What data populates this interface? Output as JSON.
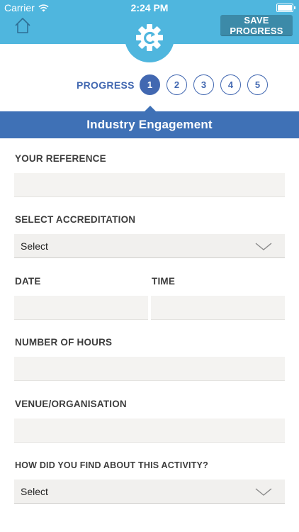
{
  "status_bar": {
    "carrier": "Carrier",
    "time": "2:24 PM"
  },
  "header": {
    "save_label": "SAVE PROGRESS"
  },
  "progress": {
    "label": "PROGRESS",
    "steps": [
      "1",
      "2",
      "3",
      "4",
      "5"
    ],
    "current": 1
  },
  "section_title": "Industry Engagement",
  "form": {
    "reference_label": "YOUR REFERENCE",
    "accreditation_label": "SELECT ACCREDITATION",
    "accreditation_value": "Select",
    "date_label": "DATE",
    "time_label": "TIME",
    "hours_label": "NUMBER OF HOURS",
    "venue_label": "VENUE/ORGANISATION",
    "found_label": "HOW DID YOU FIND ABOUT THIS ACTIVITY?",
    "found_value": "Select"
  },
  "colors": {
    "header": "#4fb6de",
    "save_button": "#3c8aa8",
    "primary_blue": "#4268b1",
    "banner": "#3f71b6",
    "input_bg": "#f4f3f1"
  }
}
